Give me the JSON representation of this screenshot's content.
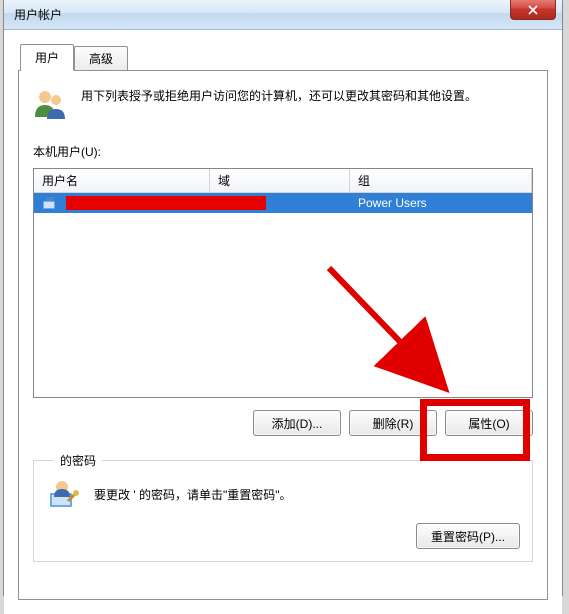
{
  "window": {
    "title": "用户帐户"
  },
  "tabs": {
    "users": "用户",
    "advanced": "高级"
  },
  "intro_text": "用下列表授予或拒绝用户访问您的计算机，还可以更改其密码和其他设置。",
  "list_label": "本机用户(U):",
  "columns": {
    "username": "用户名",
    "domain": "域",
    "group": "组"
  },
  "rows": [
    {
      "username": "",
      "domain": "",
      "group": "Power Users"
    }
  ],
  "buttons": {
    "add": "添加(D)...",
    "remove": "删除(R)",
    "properties": "属性(O)"
  },
  "password_group": {
    "legend": "的密码",
    "text": "要更改 ' 的密码，请单击\"重置密码\"。",
    "reset": "重置密码(P)..."
  }
}
